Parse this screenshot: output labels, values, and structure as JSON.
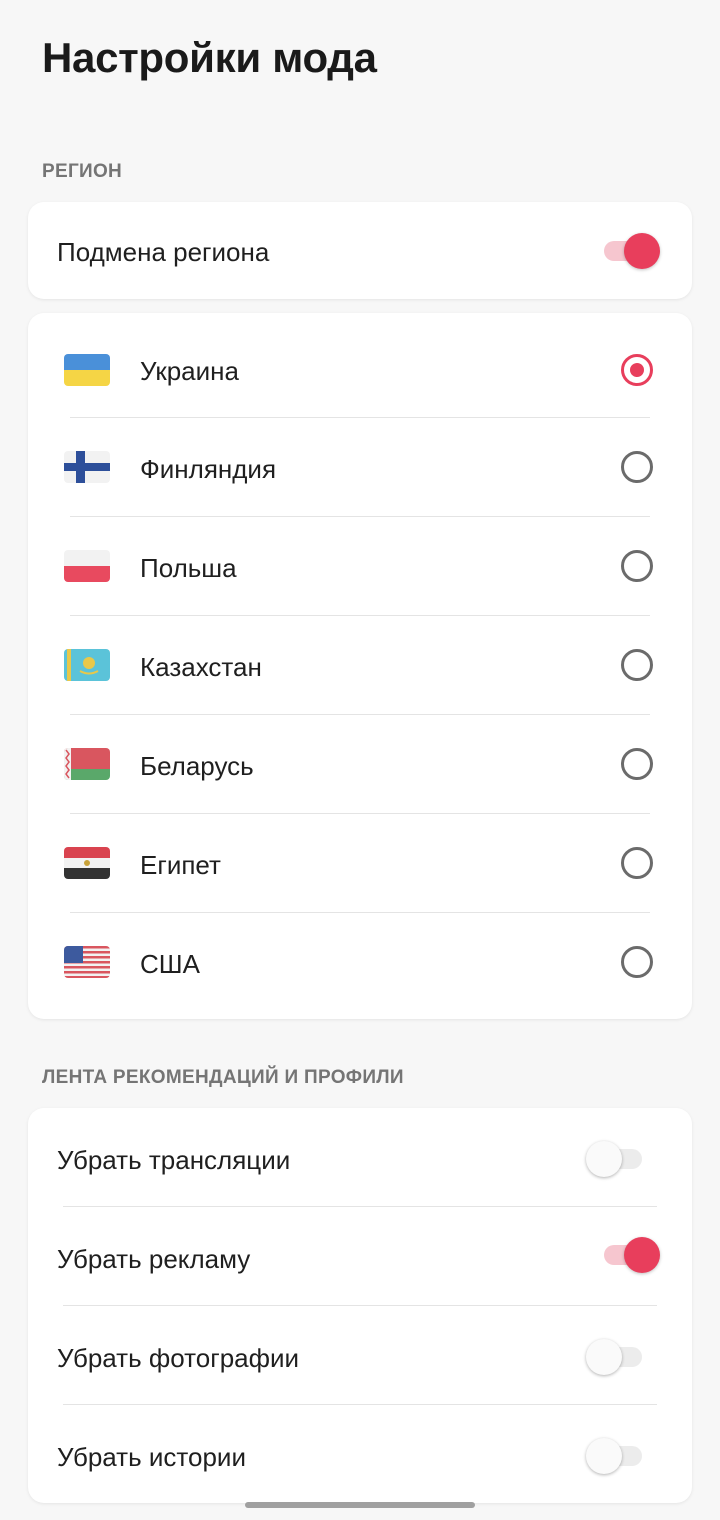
{
  "page": {
    "title": "Настройки мода"
  },
  "region": {
    "header": "РЕГИОН",
    "spoof_label": "Подмена региона",
    "spoof_on": true,
    "countries": [
      {
        "label": "Украина",
        "flag": "ukraine-flag-icon",
        "selected": true
      },
      {
        "label": "Финляндия",
        "flag": "finland-flag-icon",
        "selected": false
      },
      {
        "label": "Польша",
        "flag": "poland-flag-icon",
        "selected": false
      },
      {
        "label": "Казахстан",
        "flag": "kazakhstan-flag-icon",
        "selected": false
      },
      {
        "label": "Беларусь",
        "flag": "belarus-flag-icon",
        "selected": false
      },
      {
        "label": "Египет",
        "flag": "egypt-flag-icon",
        "selected": false
      },
      {
        "label": "США",
        "flag": "usa-flag-icon",
        "selected": false
      }
    ]
  },
  "feed": {
    "header": "ЛЕНТА РЕКОМЕНДАЦИЙ И ПРОФИЛИ",
    "items": [
      {
        "label": "Убрать трансляции",
        "on": false
      },
      {
        "label": "Убрать рекламу",
        "on": true
      },
      {
        "label": "Убрать фотографии",
        "on": false
      },
      {
        "label": "Убрать истории",
        "on": false
      }
    ]
  },
  "colors": {
    "accent": "#e83e5c",
    "background": "#f7f7f7",
    "card": "#ffffff",
    "section_header": "#757575"
  }
}
